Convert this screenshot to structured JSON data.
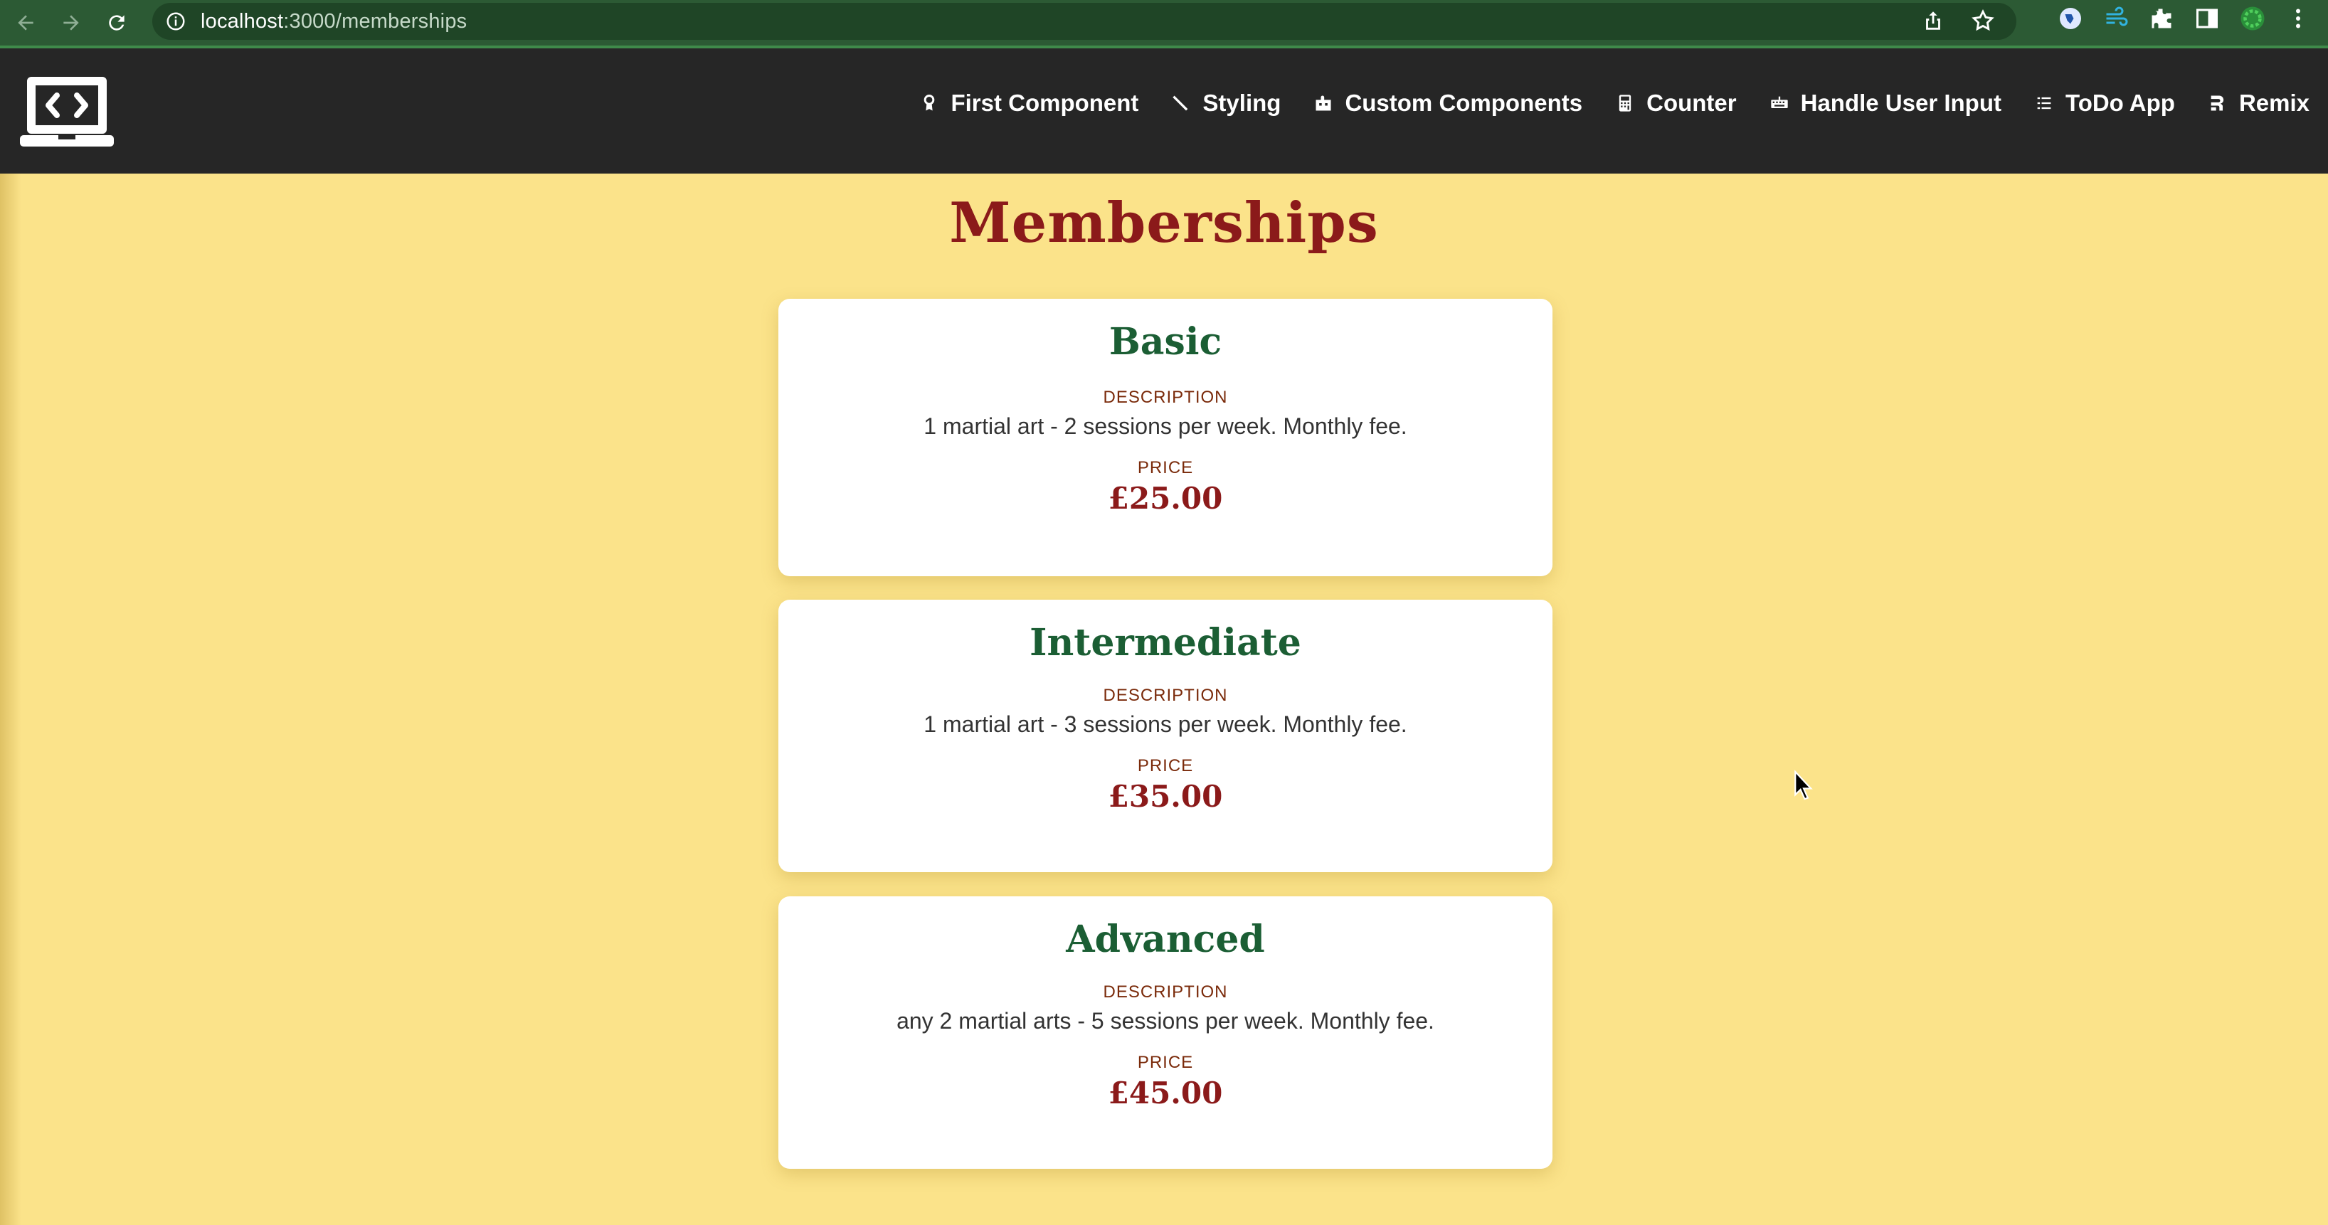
{
  "browser": {
    "url_host": "localhost",
    "url_path": ":3000/memberships"
  },
  "header": {
    "nav": [
      {
        "label": "First Component",
        "icon": "ribbon-icon"
      },
      {
        "label": "Styling",
        "icon": "brush-icon"
      },
      {
        "label": "Custom Components",
        "icon": "puzzle-icon"
      },
      {
        "label": "Counter",
        "icon": "calculator-icon"
      },
      {
        "label": "Handle User Input",
        "icon": "keyboard-icon"
      },
      {
        "label": "ToDo App",
        "icon": "list-icon"
      },
      {
        "label": "Remix",
        "icon": "remix-icon"
      }
    ]
  },
  "page": {
    "title": "Memberships",
    "description_label": "DESCRIPTION",
    "price_label": "PRICE",
    "memberships": [
      {
        "name": "Basic",
        "description": "1 martial art - 2 sessions per week. Monthly fee.",
        "price": "£25.00"
      },
      {
        "name": "Intermediate",
        "description": "1 martial art - 3 sessions per week. Monthly fee.",
        "price": "£35.00"
      },
      {
        "name": "Advanced",
        "description": "any 2 martial arts - 5 sessions per week. Monthly fee.",
        "price": "£45.00"
      }
    ]
  },
  "colors": {
    "page_bg": "#fbe38a",
    "header_bg": "#262626",
    "title": "#8b1a1a",
    "card_name": "#1b5e34",
    "browser_bar": "#2c5a34"
  }
}
